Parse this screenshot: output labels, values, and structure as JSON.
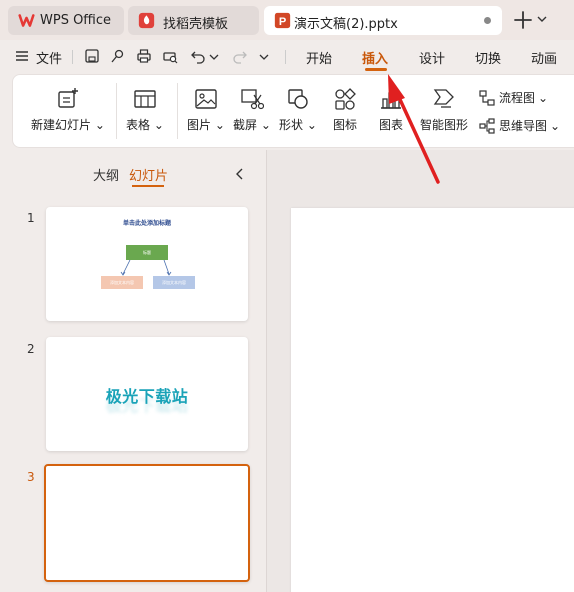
{
  "tabs": [
    {
      "label": "WPS Office"
    },
    {
      "label": "找稻壳模板"
    },
    {
      "label": "演示文稿(2).pptx"
    }
  ],
  "menu": {
    "file": "文件",
    "tabs": [
      "开始",
      "插入",
      "设计",
      "切换",
      "动画"
    ],
    "active": "插入"
  },
  "ribbon": {
    "new_slide": "新建幻灯片",
    "table": "表格",
    "picture": "图片",
    "screenshot": "截屏",
    "shape": "形状",
    "icon": "图标",
    "chart": "图表",
    "smart_graphic": "智能图形",
    "flowchart": "流程图",
    "mindmap": "思维导图"
  },
  "panel": {
    "outline_tab": "大纲",
    "slides_tab": "幻灯片"
  },
  "slides": [
    {
      "number": "1",
      "title": "单击此处添加标题",
      "top_box": "标题",
      "left_box": "添加文本内容",
      "right_box": "添加文本内容"
    },
    {
      "number": "2",
      "text": "极光下载站"
    },
    {
      "number": "3"
    }
  ],
  "colors": {
    "accent": "#d4620e",
    "annotation_arrow": "#e02020",
    "wps_logo": "#e53935",
    "doc_icon": "#d24726",
    "slide1_top_box": "#6aa84f",
    "slide1_left_box": "#f4c7b1",
    "slide1_right_box": "#b4c7e7"
  }
}
